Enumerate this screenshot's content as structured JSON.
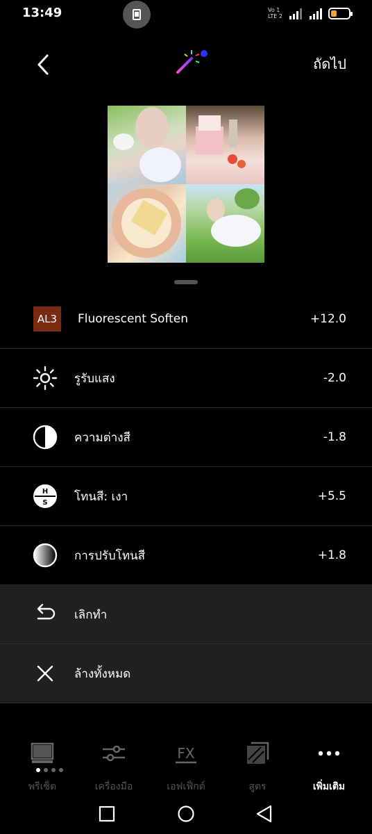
{
  "status_bar": {
    "time": "13:49",
    "net_top": "Vo 1",
    "net_bottom": "LTE 2",
    "battery_color": "#f3a23b"
  },
  "header": {
    "next_label": "ถัดไป"
  },
  "preset": {
    "badge": "AL3",
    "name": "Fluorescent Soften",
    "value": "+12.0",
    "badge_color": "#7a2a12"
  },
  "adjustments": [
    {
      "icon": "exposure-icon",
      "label": "รูรับแสง",
      "value": "-2.0"
    },
    {
      "icon": "contrast-icon",
      "label": "ความต่างสี",
      "value": "-1.8"
    },
    {
      "icon": "hs-tone-icon",
      "label": "โทนสี: เงา",
      "value": "+5.5"
    },
    {
      "icon": "tone-gradient-icon",
      "label": "การปรับโทนสี",
      "value": "+1.8"
    }
  ],
  "actions": [
    {
      "icon": "undo-icon",
      "label": "เลิกทำ"
    },
    {
      "icon": "close-icon",
      "label": "ล้างทั้งหมด"
    }
  ],
  "tabs": [
    {
      "icon": "presets-icon",
      "label": "พรีเซ็ต"
    },
    {
      "icon": "tools-icon",
      "label": "เครื่องมือ"
    },
    {
      "icon": "fx-icon",
      "label": "เอฟเฟ็กต์"
    },
    {
      "icon": "recipes-icon",
      "label": "สูตร"
    },
    {
      "icon": "more-icon",
      "label": "เพิ่มเติม",
      "active": true
    }
  ],
  "fx_text": "FX"
}
